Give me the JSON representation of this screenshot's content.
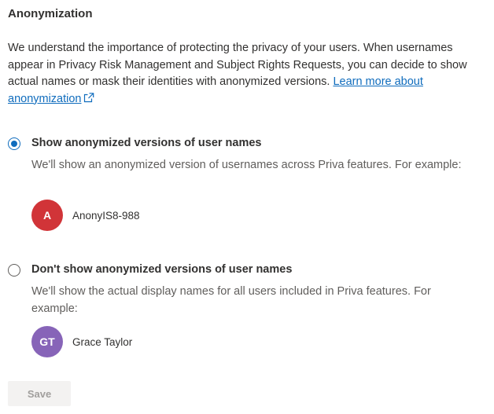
{
  "section": {
    "title": "Anonymization",
    "description": "We understand the importance of protecting the privacy of your users. When usernames appear in Privacy Risk Management and Subject Rights Requests, you can decide to show actual names or mask their identities with anonymized versions.",
    "learn_more_link": "Learn more about anonymization",
    "link_icon": "external-link-icon"
  },
  "options": [
    {
      "label": "Show anonymized versions of user names",
      "selected": true,
      "description": "We'll show an anonymized version of usernames across Priva features. For example:",
      "example": {
        "initials": "A",
        "name": "AnonyIS8-988",
        "avatar_color": "#d13438"
      }
    },
    {
      "label": "Don't show anonymized versions of user names",
      "selected": false,
      "description": "We'll show the actual display names for all users included in Priva features. For example:",
      "example": {
        "initials": "GT",
        "name": "Grace Taylor",
        "avatar_color": "#8764b8"
      }
    }
  ],
  "actions": {
    "save_label": "Save",
    "save_disabled": true
  },
  "colors": {
    "accent": "#0f6cbd",
    "text": "#323130",
    "muted": "#605e5c"
  }
}
